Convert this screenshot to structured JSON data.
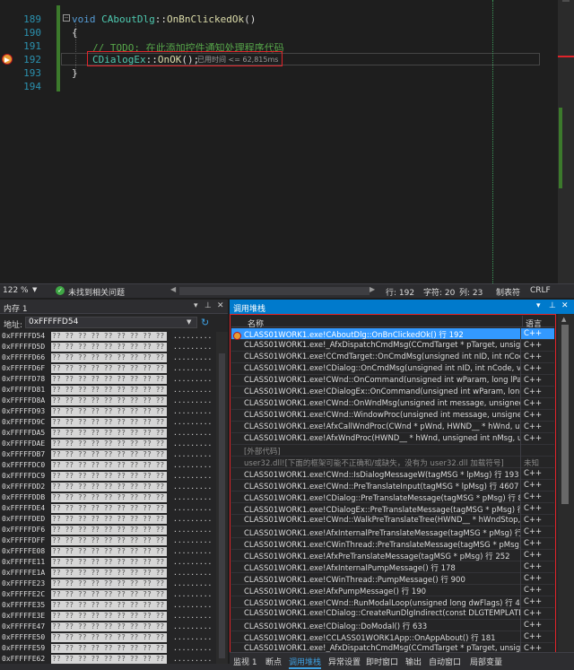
{
  "editor": {
    "line_numbers": [
      "189",
      "190",
      "191",
      "192",
      "193",
      "194"
    ],
    "code": {
      "line189_kw": "void",
      "line189_cls": "CAboutDlg",
      "line189_sep": "::",
      "line189_fn": "OnBnClickedOk",
      "line189_rest": "()",
      "line190": "{",
      "line191_comment": "// TODO: 在此添加控件通知处理程序代码",
      "line192_cls": "CDialogEx",
      "line192_sep": "::",
      "line192_fn": "OnOK",
      "line192_rest": "();",
      "line193": "}"
    },
    "perf_tip": "已用时间 <= 62,815ms",
    "fold_symbol": "−"
  },
  "status_bar": {
    "zoom": "122 %",
    "issues": "未找到相关问题",
    "line": "行: 192",
    "char": "字符: 20",
    "col": "列: 23",
    "tabs": "制表符",
    "eol": "CRLF"
  },
  "memory": {
    "title": "内存 1",
    "address_label": "地址:",
    "address_value": "0xFFFFFD54",
    "rows": [
      "0xFFFFFD54",
      "0xFFFFFD5D",
      "0xFFFFFD66",
      "0xFFFFFD6F",
      "0xFFFFFD78",
      "0xFFFFFD81",
      "0xFFFFFD8A",
      "0xFFFFFD93",
      "0xFFFFFD9C",
      "0xFFFFFDA5",
      "0xFFFFFDAE",
      "0xFFFFFDB7",
      "0xFFFFFDC0",
      "0xFFFFFDC9",
      "0xFFFFFDD2",
      "0xFFFFFDDB",
      "0xFFFFFDE4",
      "0xFFFFFDED",
      "0xFFFFFDF6",
      "0xFFFFFDFF",
      "0xFFFFFE08",
      "0xFFFFFE11",
      "0xFFFFFE1A",
      "0xFFFFFE23",
      "0xFFFFFE2C",
      "0xFFFFFE35",
      "0xFFFFFE3E",
      "0xFFFFFE47",
      "0xFFFFFE50",
      "0xFFFFFE59",
      "0xFFFFFE62"
    ],
    "hex_text": "?? ?? ?? ?? ?? ?? ?? ?? ??",
    "ascii_text": "........."
  },
  "callstack": {
    "title": "调用堆栈",
    "col_name": "名称",
    "col_lang": "语言",
    "rows": [
      {
        "name": "CLASS01WORK1.exe!CAboutDlg::OnBnClickedOk() 行 192",
        "lang": "C++",
        "state": "sel"
      },
      {
        "name": "CLASS01WORK1.exe!_AfxDispatchCmdMsg(CCmdTarget * pTarget, unsigned ...",
        "lang": "C++",
        "state": ""
      },
      {
        "name": "CLASS01WORK1.exe!CCmdTarget::OnCmdMsg(unsigned int nID, int nCode, v...",
        "lang": "C++",
        "state": ""
      },
      {
        "name": "CLASS01WORK1.exe!CDialog::OnCmdMsg(unsigned int nID, int nCode, void ...",
        "lang": "C++",
        "state": ""
      },
      {
        "name": "CLASS01WORK1.exe!CWnd::OnCommand(unsigned int wParam, long lParam)...",
        "lang": "C++",
        "state": ""
      },
      {
        "name": "CLASS01WORK1.exe!CDialogEx::OnCommand(unsigned int wParam, long lPa...",
        "lang": "C++",
        "state": ""
      },
      {
        "name": "CLASS01WORK1.exe!CWnd::OnWndMsg(unsigned int message, unsigned int ...",
        "lang": "C++",
        "state": ""
      },
      {
        "name": "CLASS01WORK1.exe!CWnd::WindowProc(unsigned int message, unsigned int...",
        "lang": "C++",
        "state": ""
      },
      {
        "name": "CLASS01WORK1.exe!AfxCallWndProc(CWnd * pWnd, HWND__ * hWnd, unsig...",
        "lang": "C++",
        "state": ""
      },
      {
        "name": "CLASS01WORK1.exe!AfxWndProc(HWND__ * hWnd, unsigned int nMsg, unsi...",
        "lang": "C++",
        "state": ""
      },
      {
        "name": "[外部代码]",
        "lang": "",
        "state": "dim"
      },
      {
        "name": "user32.dll![下面的框架可能不正确和/或缺失，没有为 user32.dll 加载符号]",
        "lang": "未知",
        "state": "dim"
      },
      {
        "name": "CLASS01WORK1.exe!CWnd::IsDialogMessageW(tagMSG * lpMsg) 行 193",
        "lang": "C++",
        "state": ""
      },
      {
        "name": "CLASS01WORK1.exe!CWnd::PreTranslateInput(tagMSG * lpMsg) 行 4607",
        "lang": "C++",
        "state": ""
      },
      {
        "name": "CLASS01WORK1.exe!CDialog::PreTranslateMessage(tagMSG * pMsg) 行 80",
        "lang": "C++",
        "state": ""
      },
      {
        "name": "CLASS01WORK1.exe!CDialogEx::PreTranslateMessage(tagMSG * pMsg) 行 275",
        "lang": "C++",
        "state": ""
      },
      {
        "name": "CLASS01WORK1.exe!CWnd::WalkPreTranslateTree(HWND__ * hWndStop, tag...",
        "lang": "C++",
        "state": ""
      },
      {
        "name": "CLASS01WORK1.exe!AfxInternalPreTranslateMessage(tagMSG * pMsg) 行 233",
        "lang": "C++",
        "state": ""
      },
      {
        "name": "CLASS01WORK1.exe!CWinThread::PreTranslateMessage(tagMSG * pMsg) 行 ...",
        "lang": "C++",
        "state": ""
      },
      {
        "name": "CLASS01WORK1.exe!AfxPreTranslateMessage(tagMSG * pMsg) 行 252",
        "lang": "C++",
        "state": ""
      },
      {
        "name": "CLASS01WORK1.exe!AfxInternalPumpMessage() 行 178",
        "lang": "C++",
        "state": ""
      },
      {
        "name": "CLASS01WORK1.exe!CWinThread::PumpMessage() 行 900",
        "lang": "C++",
        "state": ""
      },
      {
        "name": "CLASS01WORK1.exe!AfxPumpMessage() 行 190",
        "lang": "C++",
        "state": ""
      },
      {
        "name": "CLASS01WORK1.exe!CWnd::RunModalLoop(unsigned long dwFlags) 行 4661",
        "lang": "C++",
        "state": ""
      },
      {
        "name": "CLASS01WORK1.exe!CDialog::CreateRunDlgIndirect(const DLGTEMPLATE * lpD...",
        "lang": "C++",
        "state": ""
      },
      {
        "name": "CLASS01WORK1.exe!CDialog::DoModal() 行 633",
        "lang": "C++",
        "state": ""
      },
      {
        "name": "CLASS01WORK1.exe!CCLASS01WORK1App::OnAppAbout() 行 181",
        "lang": "C++",
        "state": ""
      },
      {
        "name": "CLASS01WORK1.exe!_AfxDispatchCmdMsg(CCmdTarget * pTarget, unsigned ...",
        "lang": "C++",
        "state": ""
      },
      {
        "name": "CLASS01WORK1.exe!CCmdTarget::OnCmdMsg(unsigned int nID, int nCode, v...",
        "lang": "C++",
        "state": ""
      }
    ]
  },
  "bottom_tabs": [
    "监视 1",
    "断点",
    "调用堆栈",
    "异常设置",
    "即时窗口",
    "输出",
    "自动窗口",
    "局部变量"
  ],
  "active_tab": "调用堆栈",
  "colors": {
    "accent": "#007acc",
    "highlight_red": "#e0242a",
    "selection": "#3399ff"
  }
}
